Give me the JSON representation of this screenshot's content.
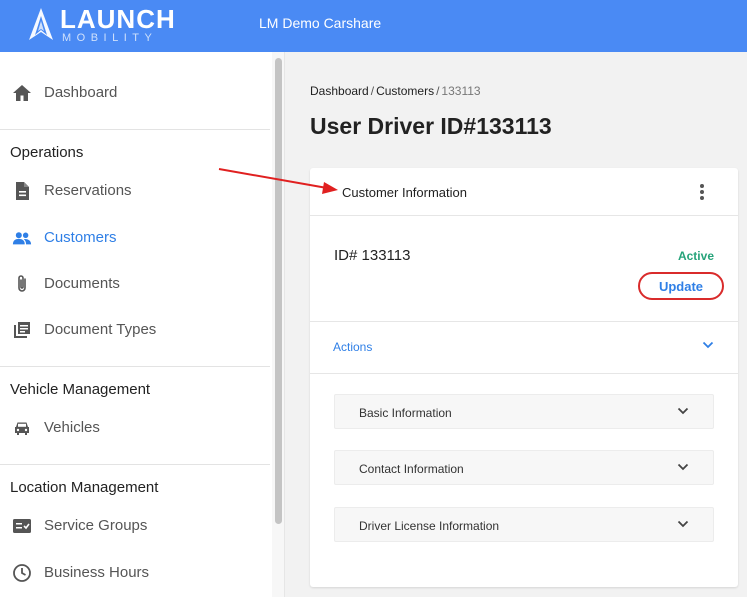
{
  "header": {
    "logo_word": "LAUNCH",
    "logo_sub": "MOBILITY",
    "app_title": "LM Demo Carshare",
    "color": "#4a8af4"
  },
  "sidebar": {
    "top_item": {
      "label": "Dashboard",
      "icon": "home-icon"
    },
    "sections": [
      {
        "heading": "Operations",
        "items": [
          {
            "label": "Reservations",
            "icon": "document-icon"
          },
          {
            "label": "Customers",
            "icon": "people-icon",
            "active": true
          },
          {
            "label": "Documents",
            "icon": "paperclip-icon"
          },
          {
            "label": "Document Types",
            "icon": "library-icon"
          }
        ]
      },
      {
        "heading": "Vehicle Management",
        "items": [
          {
            "label": "Vehicles",
            "icon": "car-icon"
          }
        ]
      },
      {
        "heading": "Location Management",
        "items": [
          {
            "label": "Service Groups",
            "icon": "checklist-icon"
          },
          {
            "label": "Business Hours",
            "icon": "clock-icon"
          }
        ]
      }
    ],
    "active_color": "#2f7fe6"
  },
  "breadcrumb": {
    "items": [
      "Dashboard",
      "Customers"
    ],
    "separator": "/",
    "current": "133113"
  },
  "page": {
    "title": "User Driver ID#133113"
  },
  "card": {
    "title": "Customer Information",
    "customer_id": "ID# 133113",
    "status": "Active",
    "status_color": "#26a37a",
    "update_label": "Update",
    "actions_label": "Actions",
    "sections": [
      {
        "label": "Basic Information"
      },
      {
        "label": "Contact Information"
      },
      {
        "label": "Driver License Information"
      }
    ]
  },
  "annotation_color": "#e02020"
}
